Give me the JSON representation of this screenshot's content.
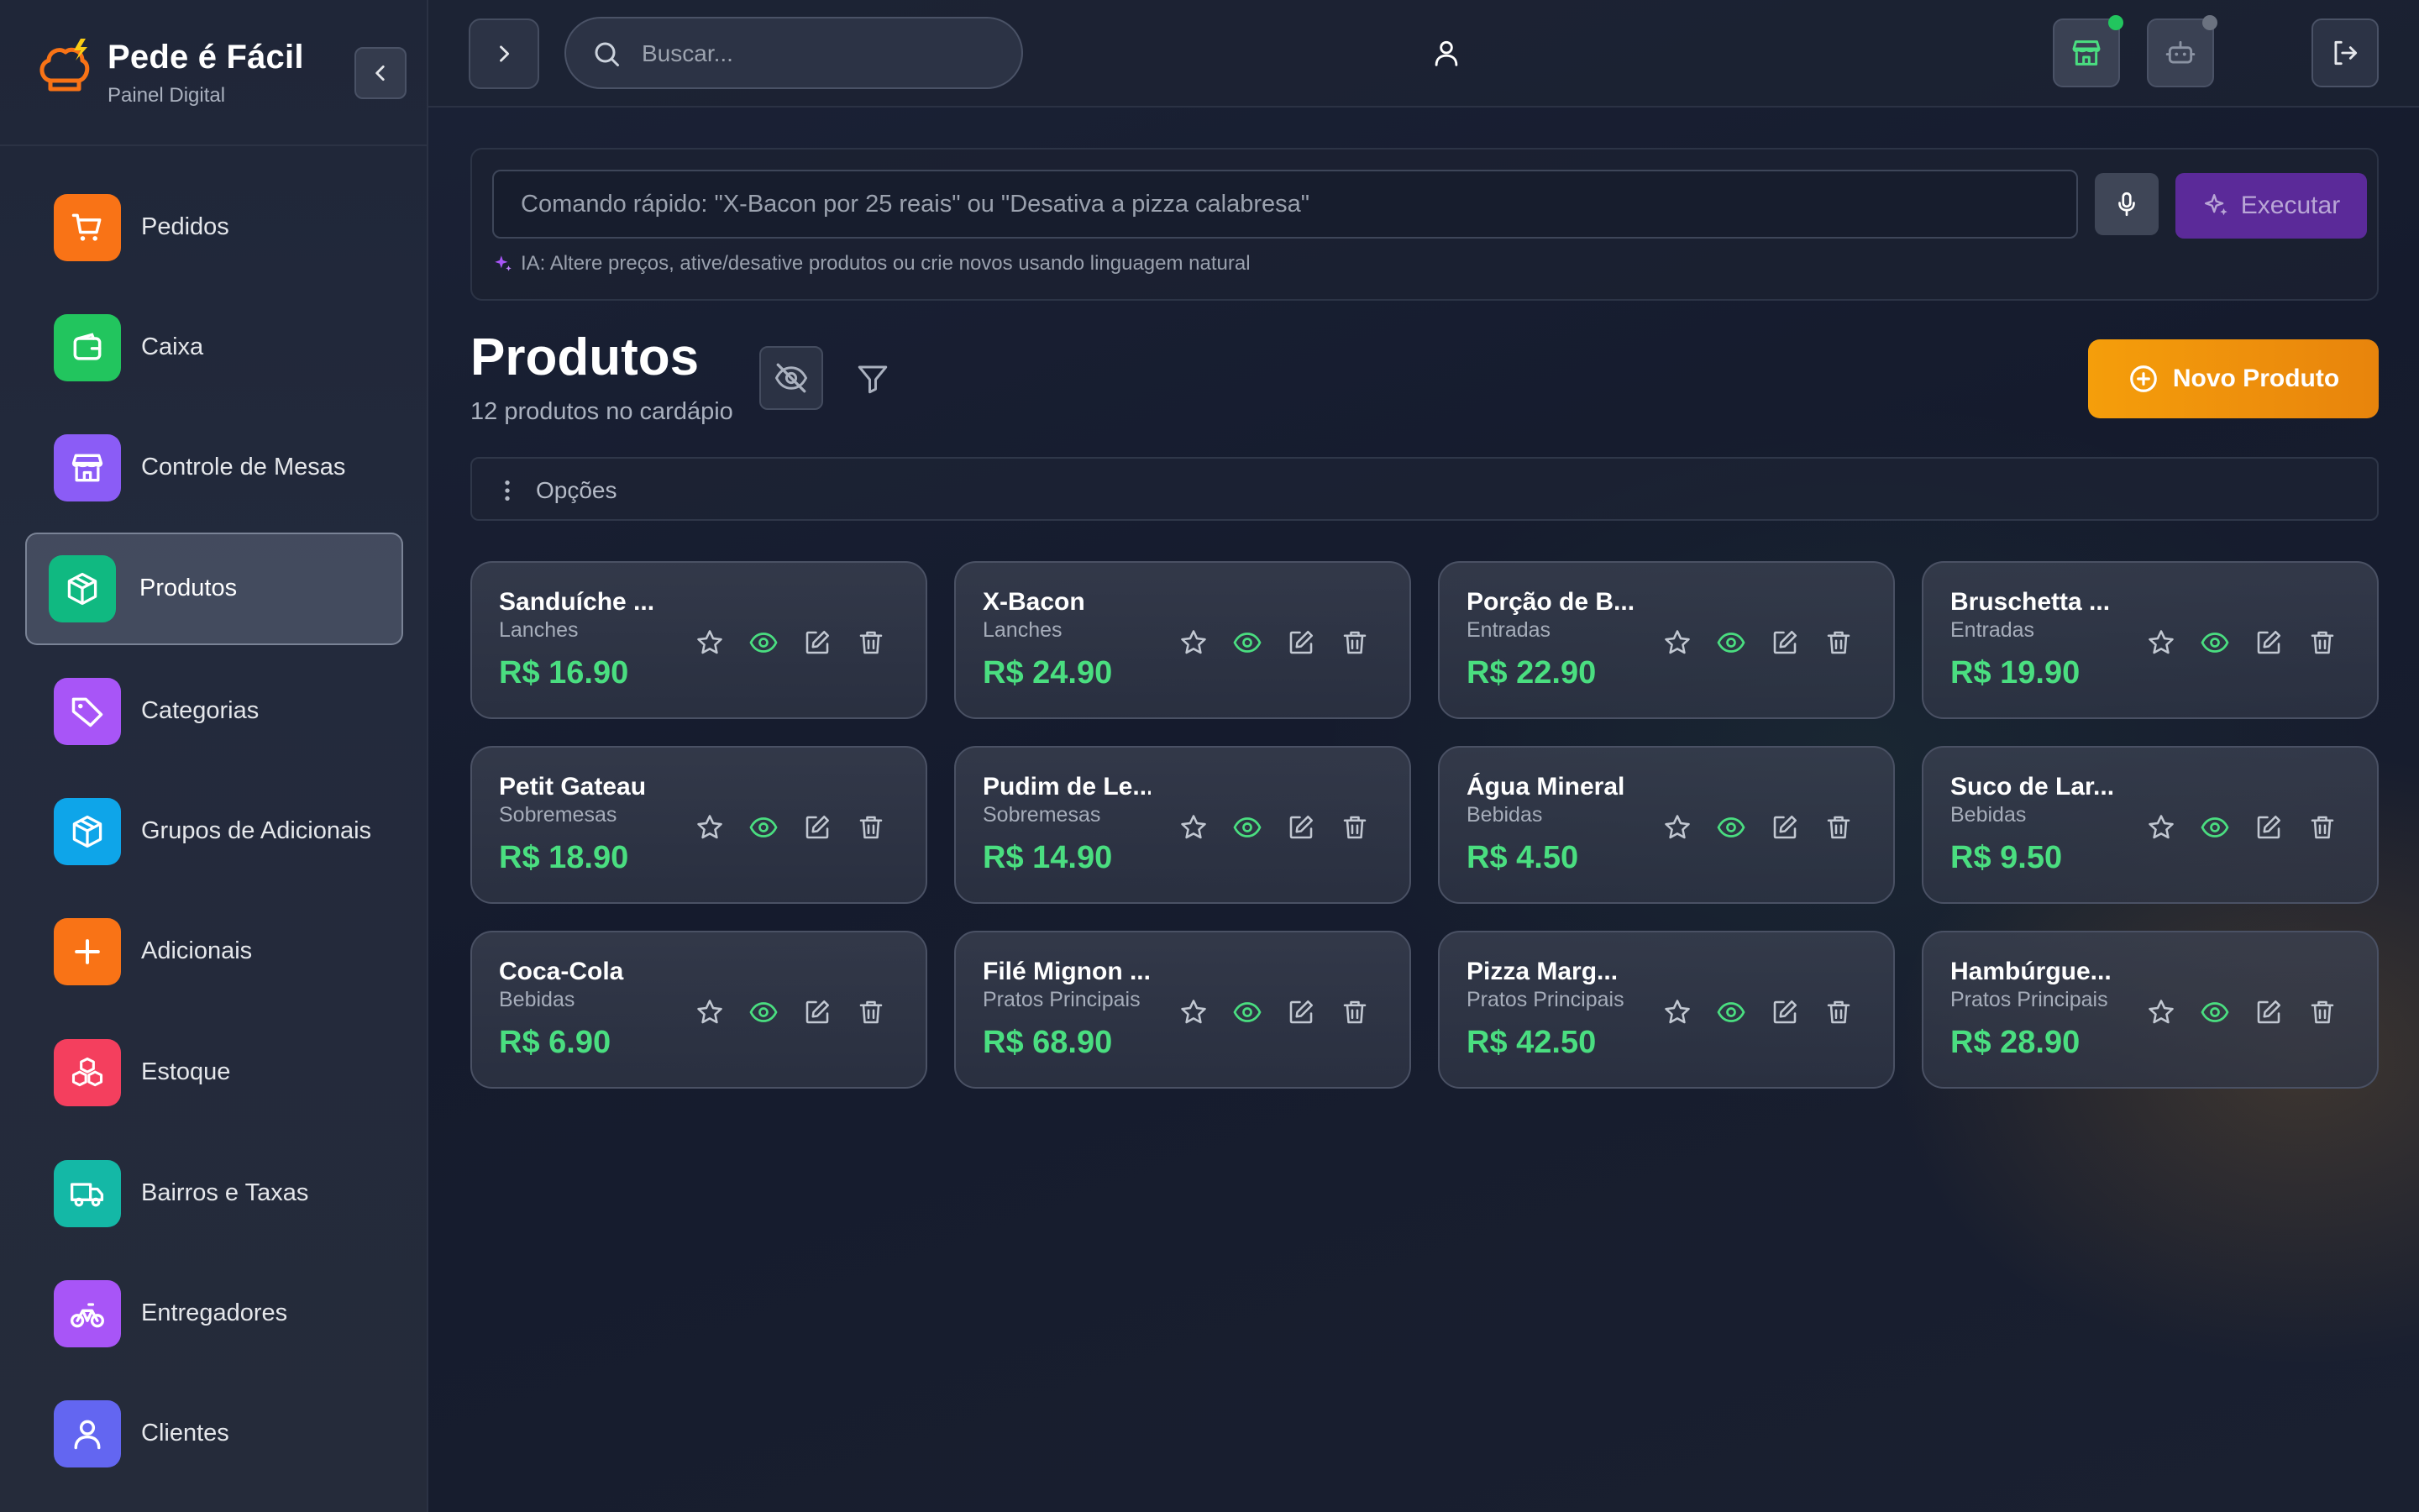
{
  "app": {
    "name": "Pede é Fácil",
    "subtitle": "Painel Digital"
  },
  "sidebar": {
    "items": [
      {
        "label": "Pedidos",
        "icon": "shopping-cart-icon",
        "color": "#f97316",
        "active": false
      },
      {
        "label": "Caixa",
        "icon": "wallet-icon",
        "color": "#22c55e",
        "active": false
      },
      {
        "label": "Controle de Mesas",
        "icon": "store-icon",
        "color": "#8b5cf6",
        "active": false
      },
      {
        "label": "Produtos",
        "icon": "package-icon",
        "color": "#10b981",
        "active": true
      },
      {
        "label": "Categorias",
        "icon": "tag-icon",
        "color": "#a855f7",
        "active": false
      },
      {
        "label": "Grupos de Adicionais",
        "icon": "package-icon",
        "color": "#0ea5e9",
        "active": false
      },
      {
        "label": "Adicionais",
        "icon": "plus-icon",
        "color": "#f97316",
        "active": false
      },
      {
        "label": "Estoque",
        "icon": "boxes-icon",
        "color": "#f43f5e",
        "active": false
      },
      {
        "label": "Bairros e Taxas",
        "icon": "truck-icon",
        "color": "#14b8a6",
        "active": false
      },
      {
        "label": "Entregadores",
        "icon": "bike-icon",
        "color": "#a855f7",
        "active": false
      },
      {
        "label": "Clientes",
        "icon": "user-icon",
        "color": "#6366f1",
        "active": false
      }
    ]
  },
  "topbar": {
    "search_placeholder": "Buscar...",
    "store_status_color": "#22c55e",
    "bot_status_color": "#6b7280"
  },
  "command": {
    "placeholder": "Comando rápido: \"X-Bacon por 25 reais\" ou \"Desativa a pizza calabresa\"",
    "execute_label": "Executar",
    "hint": "IA: Altere preços, ative/desative produtos ou crie novos usando linguagem natural"
  },
  "page": {
    "title": "Produtos",
    "subtitle": "12 produtos no cardápio",
    "new_button": "Novo Produto",
    "options_label": "Opções"
  },
  "products": [
    {
      "name": "Sanduíche ...",
      "category": "Lanches",
      "price": "R$ 16.90"
    },
    {
      "name": "X-Bacon",
      "category": "Lanches",
      "price": "R$ 24.90"
    },
    {
      "name": "Porção de B...",
      "category": "Entradas",
      "price": "R$ 22.90"
    },
    {
      "name": "Bruschetta ...",
      "category": "Entradas",
      "price": "R$ 19.90"
    },
    {
      "name": "Petit Gateau",
      "category": "Sobremesas",
      "price": "R$ 18.90"
    },
    {
      "name": "Pudim de Le...",
      "category": "Sobremesas",
      "price": "R$ 14.90"
    },
    {
      "name": "Água Mineral",
      "category": "Bebidas",
      "price": "R$ 4.50"
    },
    {
      "name": "Suco de Lar...",
      "category": "Bebidas",
      "price": "R$ 9.50"
    },
    {
      "name": "Coca-Cola",
      "category": "Bebidas",
      "price": "R$ 6.90"
    },
    {
      "name": "Filé Mignon ...",
      "category": "Pratos Principais",
      "price": "R$ 68.90"
    },
    {
      "name": "Pizza Marg...",
      "category": "Pratos Principais",
      "price": "R$ 42.50"
    },
    {
      "name": "Hambúrgue...",
      "category": "Pratos Principais",
      "price": "R$ 28.90"
    }
  ],
  "colors": {
    "price": "#4ade80",
    "visible_icon": "#4ade80",
    "accent": "#f59e0b",
    "ai": "#7c3aed"
  }
}
